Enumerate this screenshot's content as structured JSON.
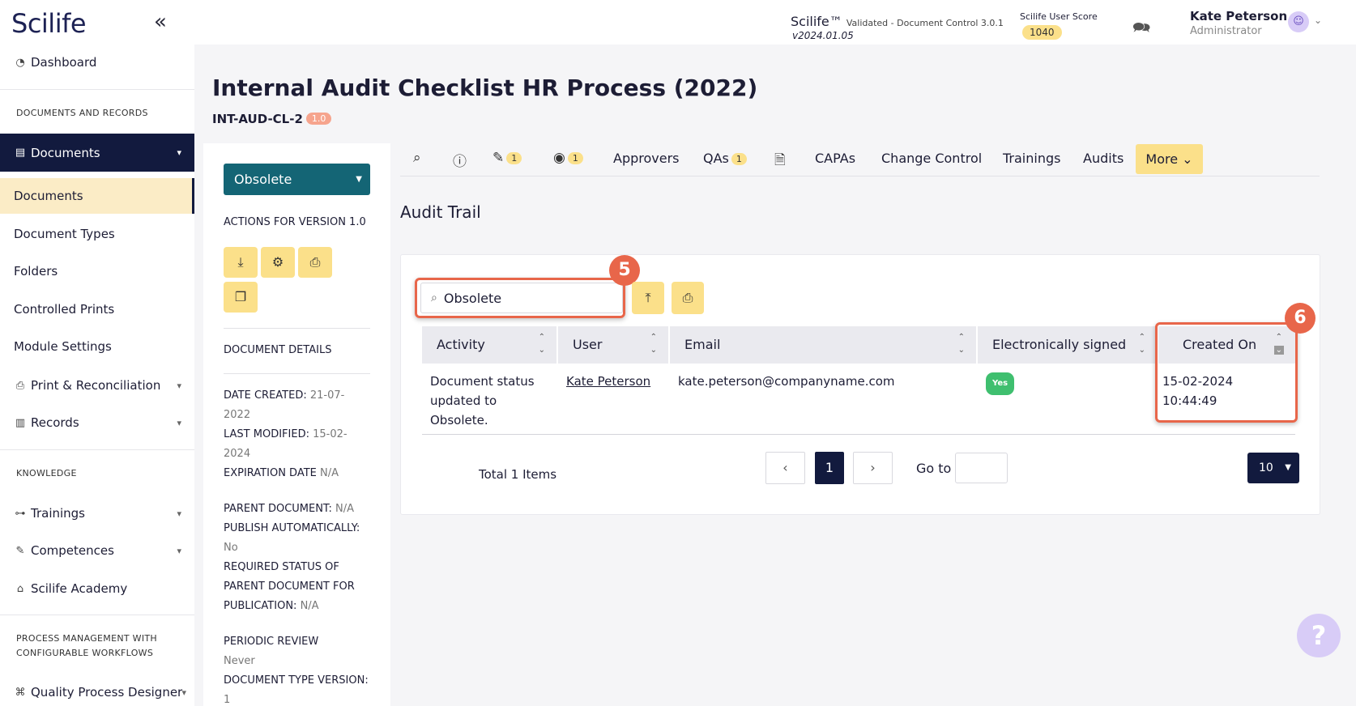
{
  "app": {
    "logo": "Scilife",
    "collapse_icon": "double-chevron-left-icon"
  },
  "sidebar": {
    "dashboard": "Dashboard",
    "section_docs": "DOCUMENTS AND RECORDS",
    "documents_group": "Documents",
    "sub_items": [
      "Documents",
      "Document Types",
      "Folders",
      "Controlled Prints",
      "Module Settings"
    ],
    "print_reconciliation": "Print & Reconciliation",
    "records": "Records",
    "section_knowledge": "KNOWLEDGE",
    "trainings": "Trainings",
    "competences": "Competences",
    "academy": "Scilife Academy",
    "section_process_1": "PROCESS MANAGEMENT WITH",
    "section_process_2": "CONFIGURABLE WORKFLOWS",
    "quality_designer": "Quality Process Designer"
  },
  "topbar": {
    "product": "Scilife™",
    "product_sub": "Validated - Document Control 3.0.1",
    "version": "v2024.01.05",
    "score_label": "Scilife User Score",
    "score": "1040",
    "user_name": "Kate Peterson",
    "user_role": "Administrator"
  },
  "document": {
    "title": "Internal Audit Checklist HR Process (2022)",
    "code": "INT-AUD-CL-2",
    "version_badge": "1.0"
  },
  "left_panel": {
    "status": "Obsolete",
    "actions_label": "ACTIONS FOR VERSION 1.0",
    "details_label": "DOCUMENT DETAILS",
    "date_created_label": "DATE CREATED:",
    "date_created_1": "21-07-",
    "date_created_2": "2022",
    "last_modified_label": "LAST MODIFIED:",
    "last_modified_1": "15-02-",
    "last_modified_2": "2024",
    "expiration_label": "EXPIRATION DATE",
    "expiration_value": "N/A",
    "parent_doc_label": "PARENT DOCUMENT:",
    "parent_doc_value": "N/A",
    "publish_auto_label": "PUBLISH AUTOMATICALLY:",
    "publish_auto_value": "No",
    "required_status_1": "REQUIRED STATUS OF",
    "required_status_2": "PARENT DOCUMENT FOR",
    "required_status_3": "PUBLICATION:",
    "required_status_value": "N/A",
    "periodic_review_label": "PERIODIC REVIEW",
    "periodic_review_value": "Never",
    "doc_type_version_label": "DOCUMENT TYPE VERSION:",
    "doc_type_version_value": "1"
  },
  "tabs": {
    "edit_count": "1",
    "view_count": "1",
    "approvers": "Approvers",
    "qas": "QAs",
    "qas_count": "1",
    "capas": "CAPAs",
    "change_control": "Change Control",
    "trainings": "Trainings",
    "audits": "Audits",
    "more": "More"
  },
  "audit_trail": {
    "title": "Audit Trail",
    "search_value": "Obsolete",
    "step_search": "5",
    "step_created": "6",
    "columns": [
      "Activity",
      "User",
      "Email",
      "Electronically signed",
      "Created On"
    ],
    "rows": [
      {
        "activity_1": "Document status",
        "activity_2": "updated to",
        "activity_3": "Obsolete.",
        "user": "Kate Peterson",
        "email": "kate.peterson@companyname.com",
        "signed": "Yes",
        "created_date": "15-02-2024",
        "created_time": "10:44:49"
      }
    ],
    "total": "Total 1 Items",
    "current_page": "1",
    "goto_label": "Go to",
    "page_size": "10"
  },
  "colors": {
    "navy": "#121a3e",
    "teal": "#146575",
    "yellow": "#fbe08a",
    "highlight": "#e8664a"
  }
}
